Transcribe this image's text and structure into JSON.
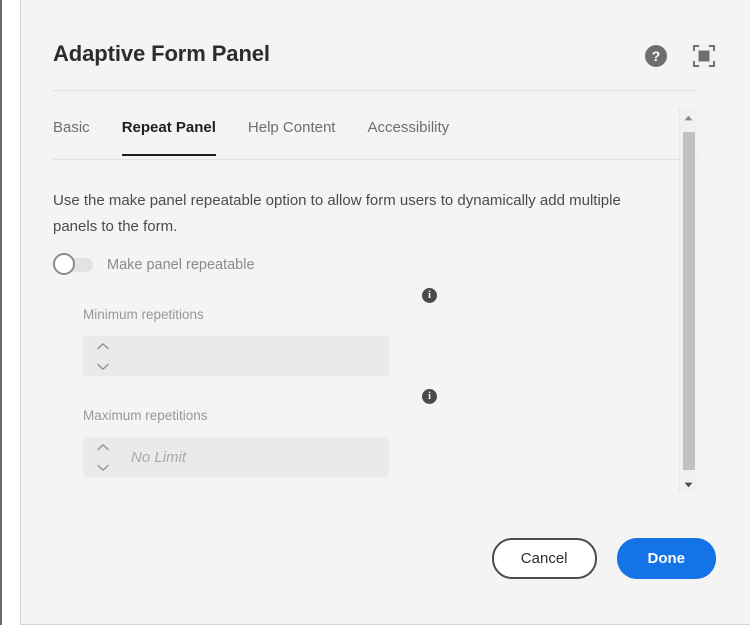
{
  "dialog": {
    "title": "Adaptive Form Panel",
    "header_actions": [
      {
        "name": "help-icon",
        "label": "Help"
      },
      {
        "name": "fullscreen-icon",
        "label": "Full screen"
      }
    ]
  },
  "tabs": [
    {
      "label": "Basic",
      "active": false
    },
    {
      "label": "Repeat Panel",
      "active": true
    },
    {
      "label": "Help Content",
      "active": false
    },
    {
      "label": "Accessibility",
      "active": false
    }
  ],
  "body": {
    "description": "Use the make panel repeatable option to allow form users to dynamically add multiple panels to the form.",
    "toggle": {
      "label": "Make panel repeatable",
      "state": "off"
    },
    "fields": [
      {
        "label": "Minimum repetitions",
        "value": "",
        "placeholder": "",
        "disabled": true,
        "info": "i"
      },
      {
        "label": "Maximum repetitions",
        "value": "",
        "placeholder": "No Limit",
        "disabled": true,
        "info": "i"
      }
    ]
  },
  "scrollbar": {
    "up_arrow": "scroll-up",
    "down_arrow": "scroll-down",
    "position": "top"
  },
  "footer": {
    "cancel_label": "Cancel",
    "done_label": "Done"
  },
  "colors": {
    "accent": "#1473e6",
    "dialog_bg": "#f4f4f4",
    "field_bg": "#eaeaea",
    "text_primary": "#2c2c2c",
    "text_secondary": "#6e6e6e",
    "text_muted": "#989898",
    "tab_active": "#1f1f1f"
  }
}
